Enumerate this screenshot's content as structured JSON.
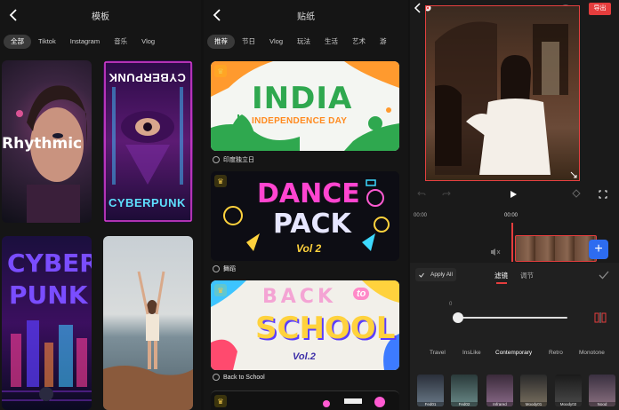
{
  "templates_panel": {
    "title": "模板",
    "tabs": [
      "全部",
      "Tiktok",
      "Instagram",
      "音乐",
      "Vlog"
    ],
    "cards": [
      {
        "text": "Rhythmic"
      },
      {
        "text_top": "CYBERPUNK",
        "text_bottom": "CYBERPUNK"
      },
      {
        "text_line1": "CYBER",
        "text_line2": "PUNK"
      },
      {}
    ]
  },
  "stickers_panel": {
    "title": "贴纸",
    "tabs": [
      "推荐",
      "节日",
      "Vlog",
      "玩法",
      "生活",
      "艺术",
      "游"
    ],
    "packs": [
      {
        "label": "印度独立日",
        "art_line1": "INDIA",
        "art_line2": "INDEPENDENCE DAY"
      },
      {
        "label": "舞蹈",
        "art_line1": "DANCE",
        "art_line2": "PACK",
        "art_line3": "Vol 2"
      },
      {
        "label": "Back to School",
        "art_line1": "BACK",
        "art_line2": "to",
        "art_line3": "SCHOOL",
        "art_line4": "Vol.2"
      }
    ]
  },
  "editor_panel": {
    "export_label": "导出",
    "help_label": "?",
    "time_left": "00:00",
    "time_center": "00:00",
    "apply_all_label": "Apply All",
    "tabs": [
      "滤镜",
      "调节"
    ],
    "slider_value": "0",
    "filter_categories": [
      "Travel",
      "InsLike",
      "Contemporary",
      "Retro",
      "Monotone"
    ],
    "filter_thumbs": [
      "Fed01",
      "Fed02",
      "Infrared",
      "Moody01",
      "Moody02",
      "Nood"
    ]
  },
  "colors": {
    "accent_red": "#e53d3d",
    "add_blue": "#2d6cf0",
    "panel_bg": "#151515"
  }
}
